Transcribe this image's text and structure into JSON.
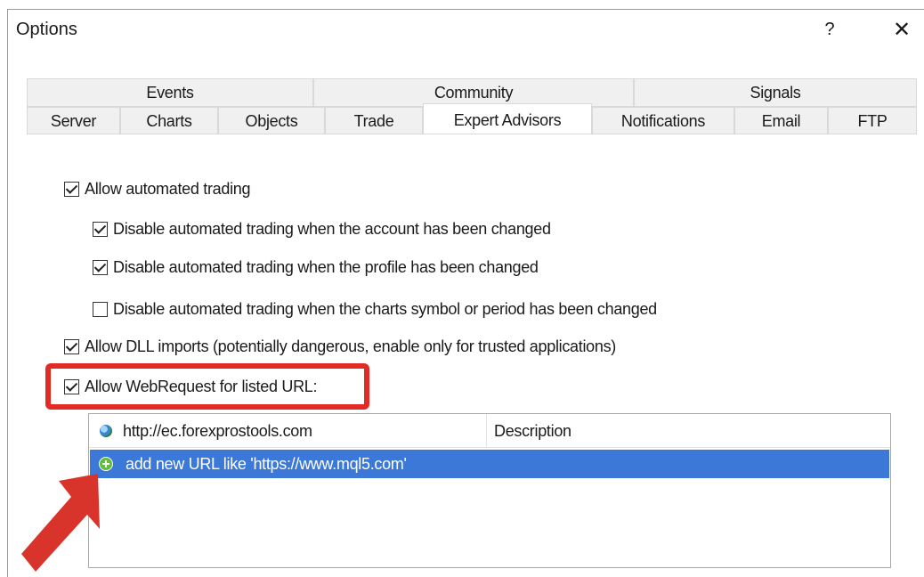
{
  "window": {
    "title": "Options",
    "help_label": "?",
    "close_label": "✕"
  },
  "tabs_row1": [
    "Events",
    "Community",
    "Signals"
  ],
  "tabs_row2": [
    "Server",
    "Charts",
    "Objects",
    "Trade",
    "Expert Advisors",
    "Notifications",
    "Email",
    "FTP"
  ],
  "selected_tab": "Expert Advisors",
  "options": [
    {
      "label": "Allow automated trading",
      "checked": true
    },
    {
      "label": "Disable automated trading when the account has been changed",
      "checked": true
    },
    {
      "label": "Disable automated trading when the profile has been changed",
      "checked": true
    },
    {
      "label": "Disable automated trading when the charts symbol or period has been changed",
      "checked": false
    },
    {
      "label": "Allow DLL imports (potentially dangerous, enable only for trusted applications)",
      "checked": true
    },
    {
      "label": "Allow WebRequest for listed URL:",
      "checked": true
    }
  ],
  "url_list": {
    "url": "http://ec.forexprostools.com",
    "description_header": "Description",
    "add_new": "add new URL like 'https://www.mql5.com'"
  },
  "colors": {
    "highlight": "#e22b25",
    "selection": "#3c78d8",
    "arrow": "#d9342b"
  }
}
